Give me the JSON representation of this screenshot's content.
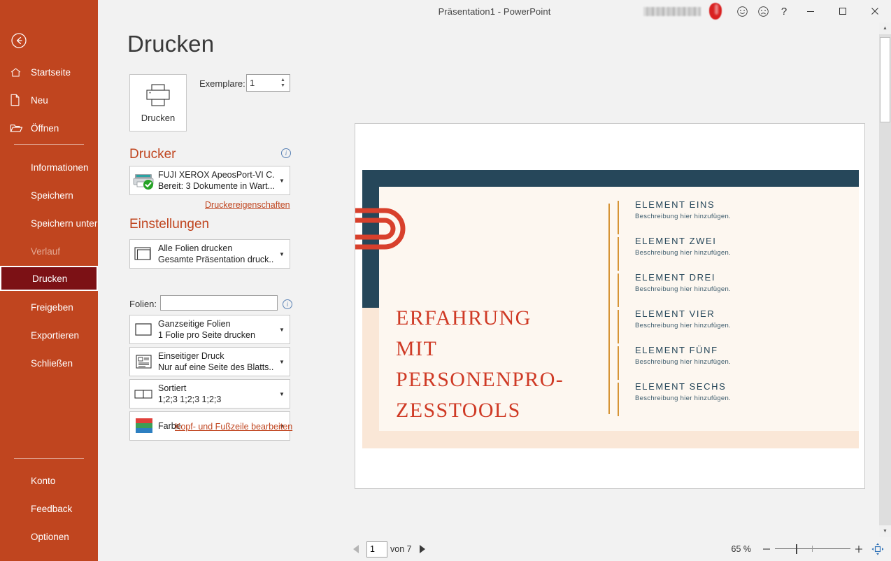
{
  "window": {
    "title": "Präsentation1  -  PowerPoint",
    "account_name_blurred": true,
    "buttons": {
      "smile": "☺",
      "frown": "☹",
      "help": "?",
      "minimize": "—",
      "maximize": "▢",
      "close": "✕"
    }
  },
  "sidebar": {
    "back_label": "Zurück",
    "items": [
      {
        "label": "Startseite",
        "icon": "home-icon",
        "state": "normal"
      },
      {
        "label": "Neu",
        "icon": "new-document-icon",
        "state": "normal"
      },
      {
        "label": "Öffnen",
        "icon": "open-folder-icon",
        "state": "normal"
      },
      {
        "label": "Informationen",
        "icon": "",
        "state": "normal"
      },
      {
        "label": "Speichern",
        "icon": "",
        "state": "normal"
      },
      {
        "label": "Speichern unter",
        "icon": "",
        "state": "normal"
      },
      {
        "label": "Verlauf",
        "icon": "",
        "state": "disabled"
      },
      {
        "label": "Drucken",
        "icon": "",
        "state": "selected"
      },
      {
        "label": "Freigeben",
        "icon": "",
        "state": "normal"
      },
      {
        "label": "Exportieren",
        "icon": "",
        "state": "normal"
      },
      {
        "label": "Schließen",
        "icon": "",
        "state": "normal"
      },
      {
        "label": "Konto",
        "icon": "",
        "state": "normal"
      },
      {
        "label": "Feedback",
        "icon": "",
        "state": "normal"
      },
      {
        "label": "Optionen",
        "icon": "",
        "state": "normal"
      }
    ],
    "colors": {
      "background": "#c0451f",
      "selected": "#7c1115",
      "disabled_text": "#e3a893"
    }
  },
  "print": {
    "page_title": "Drucken",
    "print_button_label": "Drucken",
    "copies_label": "Exemplare:",
    "copies_value": "1",
    "printer_section_heading": "Drucker",
    "printer_name": "FUJI XEROX ApeosPort-VI C...",
    "printer_status": "Bereit: 3 Dokumente in Wart...",
    "printer_properties_link": "Druckereigenschaften",
    "settings_section_heading": "Einstellungen",
    "slides_label": "Folien:",
    "slides_value": "",
    "slides_placeholder": "",
    "header_footer_link": "Kopf- und Fußzeile bearbeiten",
    "settings": [
      {
        "line1": "Alle Folien drucken",
        "line2": "Gesamte Präsentation druck...",
        "icon": "all-slides-icon"
      },
      {
        "line1": "Ganzseitige Folien",
        "line2": "1 Folie pro Seite drucken",
        "icon": "full-page-slides-icon"
      },
      {
        "line1": "Einseitiger Druck",
        "line2": "Nur auf eine Seite des Blatts...",
        "icon": "one-sided-print-icon"
      },
      {
        "line1": "Sortiert",
        "line2": "1;2;3   1;2;3   1;2;3",
        "icon": "collated-icon"
      },
      {
        "line1": "Farbe",
        "line2": "",
        "icon": "color-icon"
      }
    ]
  },
  "preview": {
    "page_current": "1",
    "page_of": "von 7",
    "zoom_percent": "65 %",
    "zoom_minus": "−",
    "zoom_plus": "+",
    "fit_to_window": "fit-to-window-icon",
    "prev_page": "◀",
    "next_page": "▶"
  },
  "slide": {
    "title": "ERFAHRUNG MIT PERSONENPRO-ZESSTOOLS",
    "title_lines": [
      "ERFAHRUNG",
      "MIT",
      "PERSONENPRO-",
      "ZESSTOOLS"
    ],
    "items": [
      {
        "heading": "ELEMENT  EINS",
        "desc": "Beschreibung  hier  hinzufügen."
      },
      {
        "heading": "ELEMENT  ZWEI",
        "desc": "Beschreibung  hier  hinzufügen."
      },
      {
        "heading": "ELEMENT  DREI",
        "desc": "Beschreibung  hier  hinzufügen."
      },
      {
        "heading": "ELEMENT  VIER",
        "desc": "Beschreibung  hier  hinzufügen."
      },
      {
        "heading": "ELEMENT  FÜNF",
        "desc": "Beschreibung  hier  hinzufügen."
      },
      {
        "heading": "ELEMENT  SECHS",
        "desc": "Beschreibung  hier  hinzufügen."
      }
    ],
    "colors": {
      "navy": "#26475a",
      "cream": "#fdf7f0",
      "peach": "#fae7d7",
      "red": "#cf3a25",
      "orange": "#d69436"
    }
  }
}
